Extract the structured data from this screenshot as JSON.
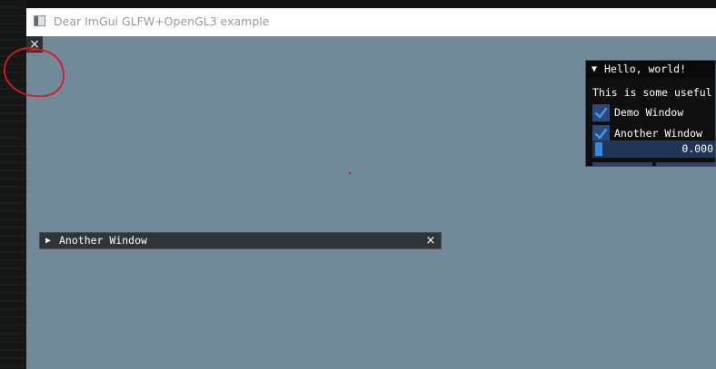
{
  "os_window": {
    "title": "Dear ImGui GLFW+OpenGL3 example",
    "icon": "app-icon"
  },
  "dismiss": {
    "label": "×",
    "icon": "close-icon"
  },
  "hello_window": {
    "title": "Hello, world!",
    "collapse_arrow": "▼",
    "text": "This is some useful text.",
    "checkboxes": [
      {
        "label": "Demo Window",
        "checked": true
      },
      {
        "label": "Another Window",
        "checked": true
      }
    ],
    "slider": {
      "value_text": "0.000",
      "fraction": 0.0
    }
  },
  "another_window": {
    "title": "Another Window",
    "expand_arrow": "▶",
    "close_label": "×"
  },
  "colors": {
    "background": "#72899a",
    "accent": "#3d85e0",
    "annotation": "#d01818"
  }
}
